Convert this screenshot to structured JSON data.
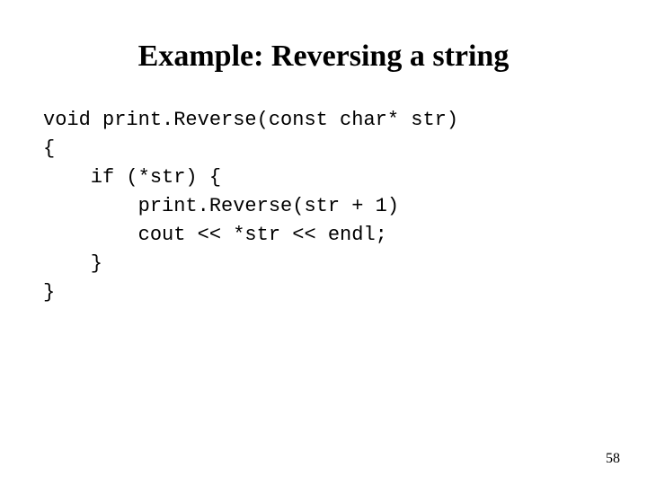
{
  "slide": {
    "title": "Example: Reversing a string",
    "code": "void print.Reverse(const char* str)\n{\n    if (*str) {\n        print.Reverse(str + 1)\n        cout << *str << endl;\n    }\n}",
    "page_number": "58"
  }
}
